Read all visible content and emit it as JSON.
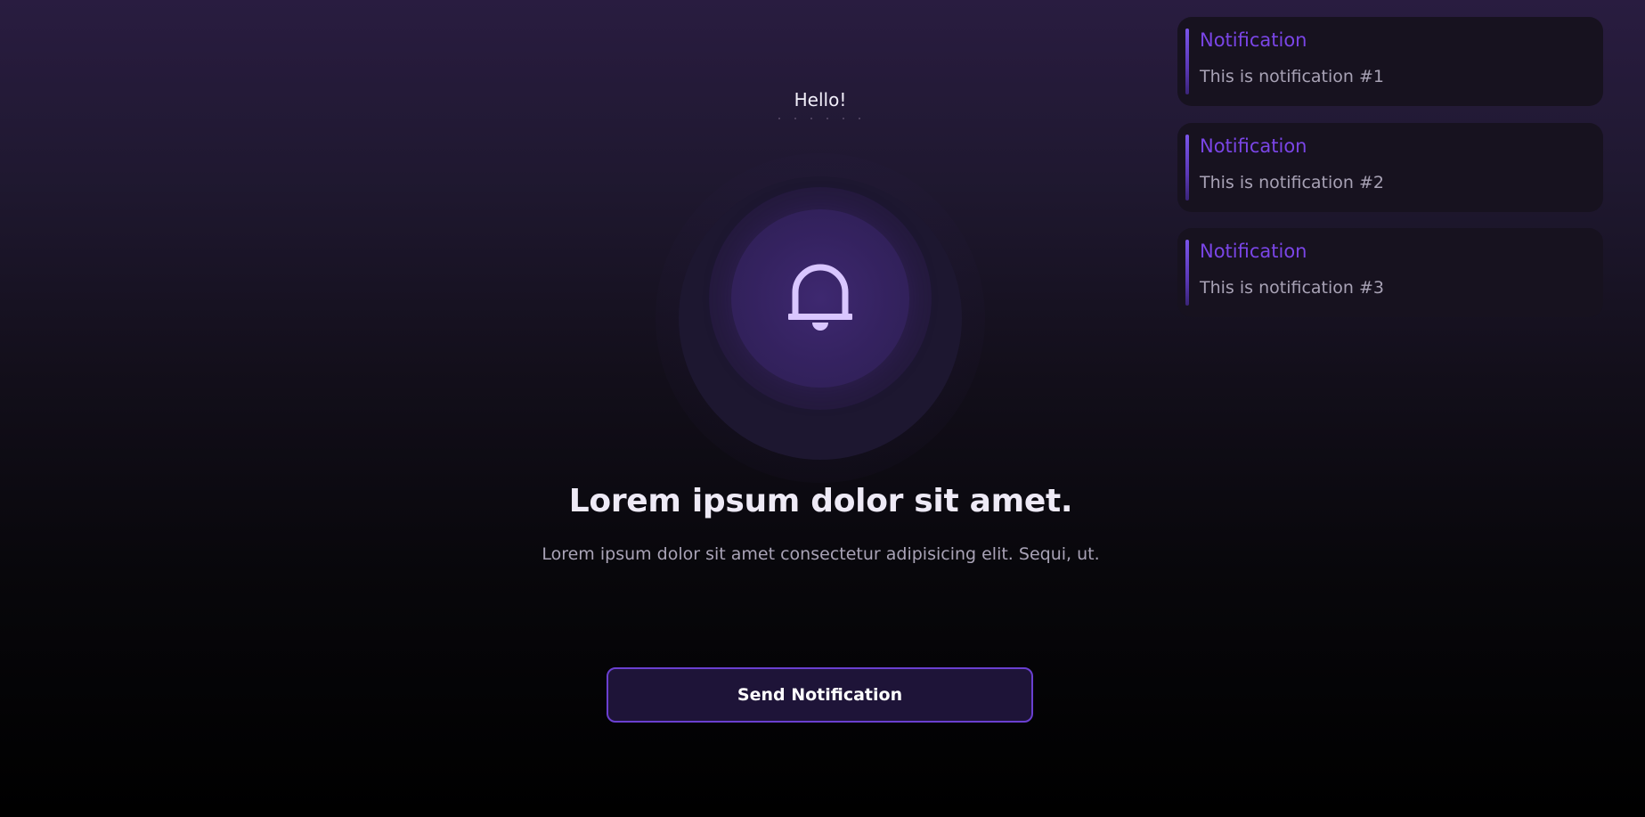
{
  "tooltip": {
    "text": "Hello!"
  },
  "hero": {
    "headline": "Lorem ipsum dolor sit amet.",
    "subtext": "Lorem ipsum dolor sit amet consectetur adipisicing elit. Sequi, ut.",
    "icon": "bell-icon"
  },
  "button": {
    "label": "Send Notification"
  },
  "notifications": [
    {
      "title": "Notification",
      "text": "This is notification #1"
    },
    {
      "title": "Notification",
      "text": "This is notification #2"
    },
    {
      "title": "Notification",
      "text": "This is notification #3"
    }
  ],
  "colors": {
    "accent": "#6a3fd0",
    "notification_title": "#7a45e6",
    "bell": "#d9c6ff",
    "button_bg": "#1e1438"
  }
}
